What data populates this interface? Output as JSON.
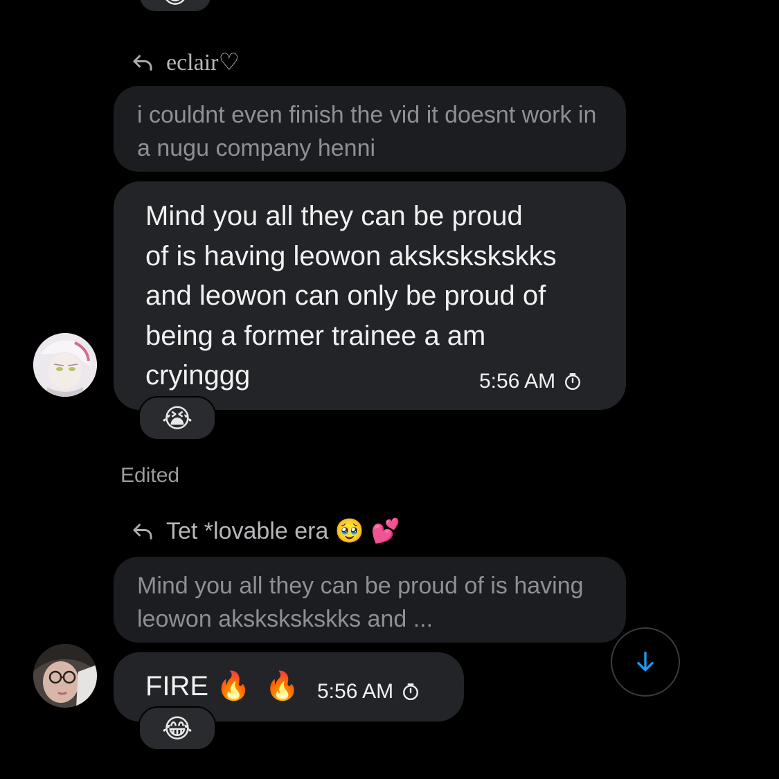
{
  "messages": [
    {
      "reply_to_name": "eclair♡",
      "quoted_text": "i couldnt even finish the vid it doesnt work in a nugu company henni",
      "text_lines": [
        "Mind you all they can be proud",
        "of is having leowon akskskskskks",
        "and leowon can only be proud of",
        "being a former trainee a am",
        "cryinggg"
      ],
      "time": "5:56 AM",
      "reaction": "😭",
      "status": "Edited"
    },
    {
      "reply_to_name": "Tet *lovable era 🥹 💕",
      "quoted_text": "Mind you all they can be proud of is having leowon akskskskskks and ...",
      "text": "FIRE",
      "emojis": "🔥 🔥",
      "time": "5:56 AM",
      "reaction": "😂"
    }
  ],
  "top_reaction": "😂",
  "icons": {
    "reply": "reply-arrow-icon",
    "clock": "clock-icon",
    "scroll_down": "arrow-down-icon"
  },
  "colors": {
    "background": "#000000",
    "bubble": "#232428",
    "quoted_bubble": "#1c1d20",
    "accent": "#1d9bf0"
  }
}
